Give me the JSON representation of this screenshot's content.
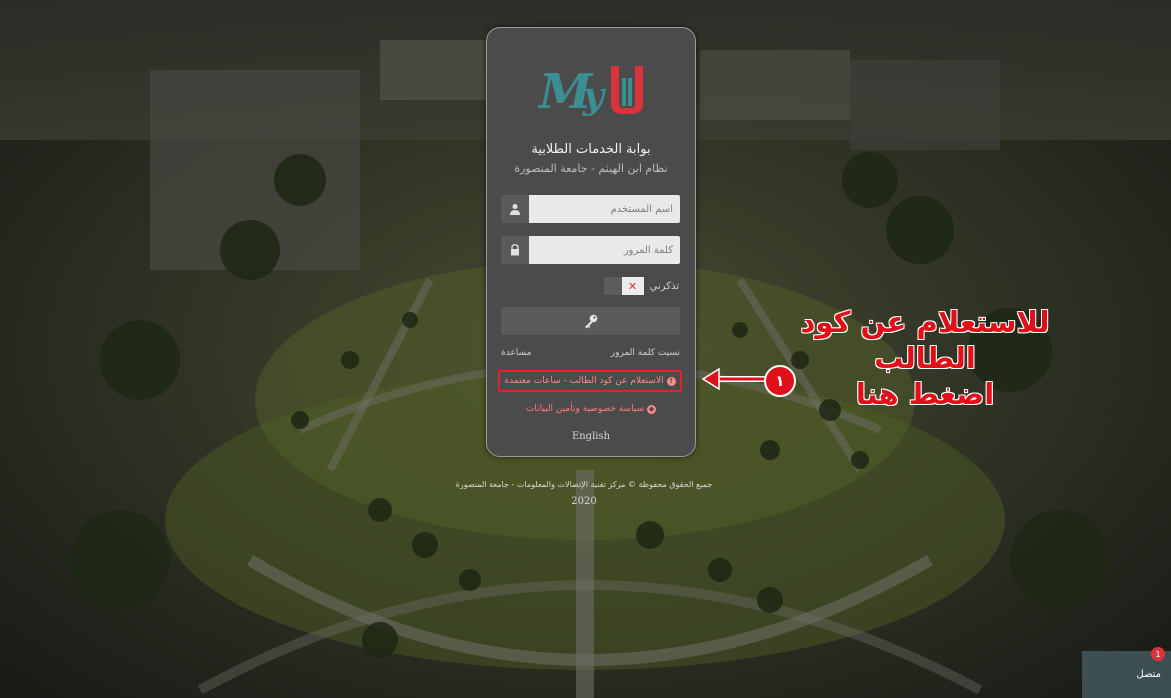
{
  "portal": {
    "title": "بوابة الخدمات الطلابية",
    "subtitle": "نظام ابن الهيثم - جامعة المنصورة"
  },
  "form": {
    "username_placeholder": "اسم المستخدم",
    "password_placeholder": "كلمة المرور",
    "remember_label": "تذكرني",
    "remember_toggle": "✕"
  },
  "links": {
    "forgot_password": "نسيت كلمة المرور",
    "help": "مساعدة",
    "inquiry": "الاستعلام عن كود الطالب - ساعات معتمدة",
    "privacy": "سياسة خصوصية وتأمين البيانات",
    "language": "English"
  },
  "footer": {
    "copyright": "جميع الحقوق محفوظة © مركز تقنية الإتصالات والمعلومات - جامعة المنصورة",
    "year": "2020"
  },
  "annotation": {
    "line1": "للاستعلام عن كود الطالب",
    "line2": "اضغط هنا",
    "step_number": "١"
  },
  "contact": {
    "label": "متصل",
    "badge": "1"
  },
  "colors": {
    "accent_red": "#e0101a",
    "logo_teal": "#3b8f92",
    "logo_red": "#d9343b"
  }
}
